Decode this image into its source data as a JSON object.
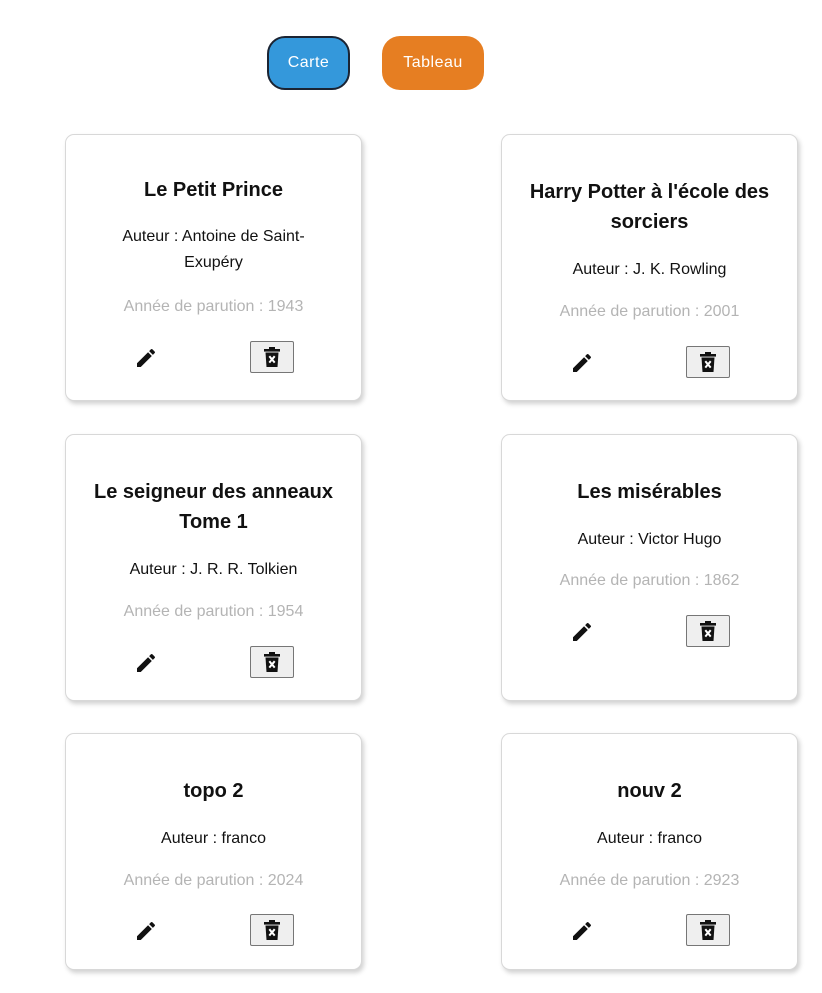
{
  "toolbar": {
    "carte_label": "Carte",
    "tableau_label": "Tableau"
  },
  "colors": {
    "carte_button": "#3498db",
    "tableau_button": "#e67e22",
    "year_text": "#b4b4b4"
  },
  "icons": {
    "edit": "pencil-icon",
    "delete": "trash-icon"
  },
  "books": [
    {
      "title": "Le Petit Prince",
      "author": "Auteur : Antoine de Saint-Exupéry",
      "year": "Année de parution : 1943"
    },
    {
      "title": "Harry Potter à l'école des sorciers",
      "author": "Auteur : J. K. Rowling",
      "year": "Année de parution : 2001"
    },
    {
      "title": "Le seigneur des anneaux Tome 1",
      "author": "Auteur : J. R. R. Tolkien",
      "year": "Année de parution : 1954"
    },
    {
      "title": "Les misérables",
      "author": "Auteur : Victor Hugo",
      "year": "Année de parution : 1862"
    },
    {
      "title": "topo 2",
      "author": "Auteur : franco",
      "year": "Année de parution : 2024"
    },
    {
      "title": "nouv 2",
      "author": "Auteur : franco",
      "year": "Année de parution : 2923"
    }
  ]
}
